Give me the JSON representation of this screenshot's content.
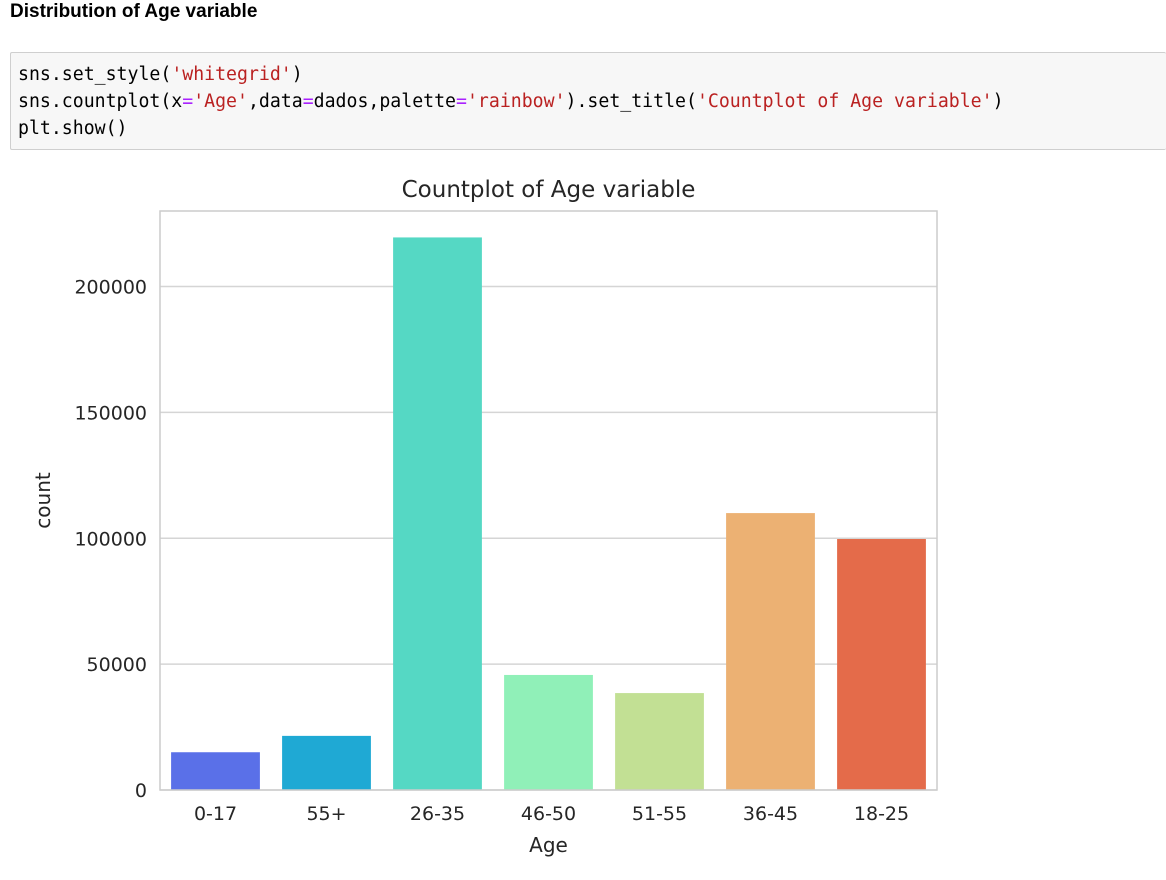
{
  "heading": "Distribution of Age variable",
  "code": {
    "line1": [
      "sns.set_style(",
      "'whitegrid'",
      ")"
    ],
    "line2": [
      "sns.countplot(x",
      "=",
      "'Age'",
      ",data",
      "=",
      "dados,palette",
      "=",
      "'rainbow'",
      ").set_title(",
      "'Countplot of Age variable'",
      ")"
    ],
    "line3": [
      "plt.show()"
    ]
  },
  "colors": {
    "code_string": "#ba2121",
    "code_operator": "#aa22ff",
    "grid": "#d5d5d5",
    "text": "#262626"
  },
  "chart_data": {
    "type": "bar",
    "title": "Countplot of Age variable",
    "xlabel": "Age",
    "ylabel": "count",
    "categories": [
      "0-17",
      "55+",
      "26-35",
      "46-50",
      "51-55",
      "36-45",
      "18-25"
    ],
    "values": [
      15000,
      21500,
      219500,
      45700,
      38500,
      110000,
      99700
    ],
    "colors": [
      "#5a70e8",
      "#1fa9d4",
      "#55d8c4",
      "#90f0b8",
      "#c2e094",
      "#ecb173",
      "#e46b4a"
    ],
    "yticks": [
      0,
      50000,
      100000,
      150000,
      200000
    ],
    "yticklabels": [
      "0",
      "50000",
      "100000",
      "150000",
      "200000"
    ],
    "ylim": [
      0,
      230000
    ],
    "grid": "horizontal"
  }
}
